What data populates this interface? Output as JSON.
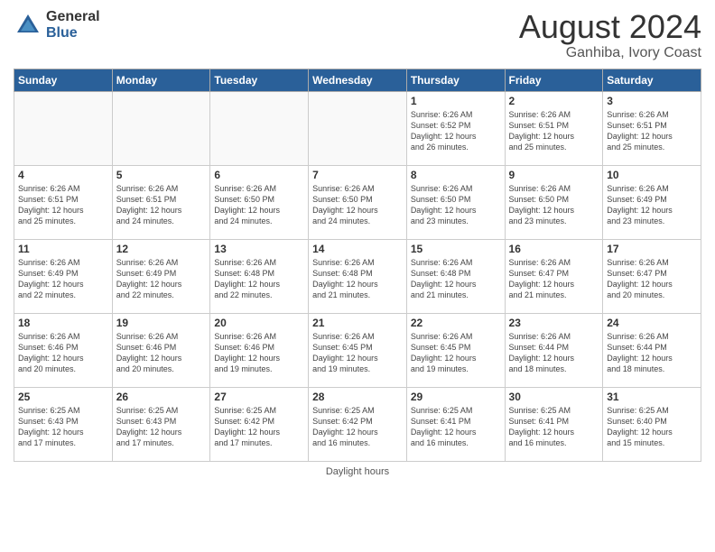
{
  "header": {
    "logo_general": "General",
    "logo_blue": "Blue",
    "main_title": "August 2024",
    "subtitle": "Ganhiba, Ivory Coast"
  },
  "calendar": {
    "days_of_week": [
      "Sunday",
      "Monday",
      "Tuesday",
      "Wednesday",
      "Thursday",
      "Friday",
      "Saturday"
    ],
    "weeks": [
      [
        {
          "day": "",
          "info": ""
        },
        {
          "day": "",
          "info": ""
        },
        {
          "day": "",
          "info": ""
        },
        {
          "day": "",
          "info": ""
        },
        {
          "day": "1",
          "info": "Sunrise: 6:26 AM\nSunset: 6:52 PM\nDaylight: 12 hours\nand 26 minutes."
        },
        {
          "day": "2",
          "info": "Sunrise: 6:26 AM\nSunset: 6:51 PM\nDaylight: 12 hours\nand 25 minutes."
        },
        {
          "day": "3",
          "info": "Sunrise: 6:26 AM\nSunset: 6:51 PM\nDaylight: 12 hours\nand 25 minutes."
        }
      ],
      [
        {
          "day": "4",
          "info": "Sunrise: 6:26 AM\nSunset: 6:51 PM\nDaylight: 12 hours\nand 25 minutes."
        },
        {
          "day": "5",
          "info": "Sunrise: 6:26 AM\nSunset: 6:51 PM\nDaylight: 12 hours\nand 24 minutes."
        },
        {
          "day": "6",
          "info": "Sunrise: 6:26 AM\nSunset: 6:50 PM\nDaylight: 12 hours\nand 24 minutes."
        },
        {
          "day": "7",
          "info": "Sunrise: 6:26 AM\nSunset: 6:50 PM\nDaylight: 12 hours\nand 24 minutes."
        },
        {
          "day": "8",
          "info": "Sunrise: 6:26 AM\nSunset: 6:50 PM\nDaylight: 12 hours\nand 23 minutes."
        },
        {
          "day": "9",
          "info": "Sunrise: 6:26 AM\nSunset: 6:50 PM\nDaylight: 12 hours\nand 23 minutes."
        },
        {
          "day": "10",
          "info": "Sunrise: 6:26 AM\nSunset: 6:49 PM\nDaylight: 12 hours\nand 23 minutes."
        }
      ],
      [
        {
          "day": "11",
          "info": "Sunrise: 6:26 AM\nSunset: 6:49 PM\nDaylight: 12 hours\nand 22 minutes."
        },
        {
          "day": "12",
          "info": "Sunrise: 6:26 AM\nSunset: 6:49 PM\nDaylight: 12 hours\nand 22 minutes."
        },
        {
          "day": "13",
          "info": "Sunrise: 6:26 AM\nSunset: 6:48 PM\nDaylight: 12 hours\nand 22 minutes."
        },
        {
          "day": "14",
          "info": "Sunrise: 6:26 AM\nSunset: 6:48 PM\nDaylight: 12 hours\nand 21 minutes."
        },
        {
          "day": "15",
          "info": "Sunrise: 6:26 AM\nSunset: 6:48 PM\nDaylight: 12 hours\nand 21 minutes."
        },
        {
          "day": "16",
          "info": "Sunrise: 6:26 AM\nSunset: 6:47 PM\nDaylight: 12 hours\nand 21 minutes."
        },
        {
          "day": "17",
          "info": "Sunrise: 6:26 AM\nSunset: 6:47 PM\nDaylight: 12 hours\nand 20 minutes."
        }
      ],
      [
        {
          "day": "18",
          "info": "Sunrise: 6:26 AM\nSunset: 6:46 PM\nDaylight: 12 hours\nand 20 minutes."
        },
        {
          "day": "19",
          "info": "Sunrise: 6:26 AM\nSunset: 6:46 PM\nDaylight: 12 hours\nand 20 minutes."
        },
        {
          "day": "20",
          "info": "Sunrise: 6:26 AM\nSunset: 6:46 PM\nDaylight: 12 hours\nand 19 minutes."
        },
        {
          "day": "21",
          "info": "Sunrise: 6:26 AM\nSunset: 6:45 PM\nDaylight: 12 hours\nand 19 minutes."
        },
        {
          "day": "22",
          "info": "Sunrise: 6:26 AM\nSunset: 6:45 PM\nDaylight: 12 hours\nand 19 minutes."
        },
        {
          "day": "23",
          "info": "Sunrise: 6:26 AM\nSunset: 6:44 PM\nDaylight: 12 hours\nand 18 minutes."
        },
        {
          "day": "24",
          "info": "Sunrise: 6:26 AM\nSunset: 6:44 PM\nDaylight: 12 hours\nand 18 minutes."
        }
      ],
      [
        {
          "day": "25",
          "info": "Sunrise: 6:25 AM\nSunset: 6:43 PM\nDaylight: 12 hours\nand 17 minutes."
        },
        {
          "day": "26",
          "info": "Sunrise: 6:25 AM\nSunset: 6:43 PM\nDaylight: 12 hours\nand 17 minutes."
        },
        {
          "day": "27",
          "info": "Sunrise: 6:25 AM\nSunset: 6:42 PM\nDaylight: 12 hours\nand 17 minutes."
        },
        {
          "day": "28",
          "info": "Sunrise: 6:25 AM\nSunset: 6:42 PM\nDaylight: 12 hours\nand 16 minutes."
        },
        {
          "day": "29",
          "info": "Sunrise: 6:25 AM\nSunset: 6:41 PM\nDaylight: 12 hours\nand 16 minutes."
        },
        {
          "day": "30",
          "info": "Sunrise: 6:25 AM\nSunset: 6:41 PM\nDaylight: 12 hours\nand 16 minutes."
        },
        {
          "day": "31",
          "info": "Sunrise: 6:25 AM\nSunset: 6:40 PM\nDaylight: 12 hours\nand 15 minutes."
        }
      ]
    ]
  },
  "footer": {
    "text": "Daylight hours"
  }
}
